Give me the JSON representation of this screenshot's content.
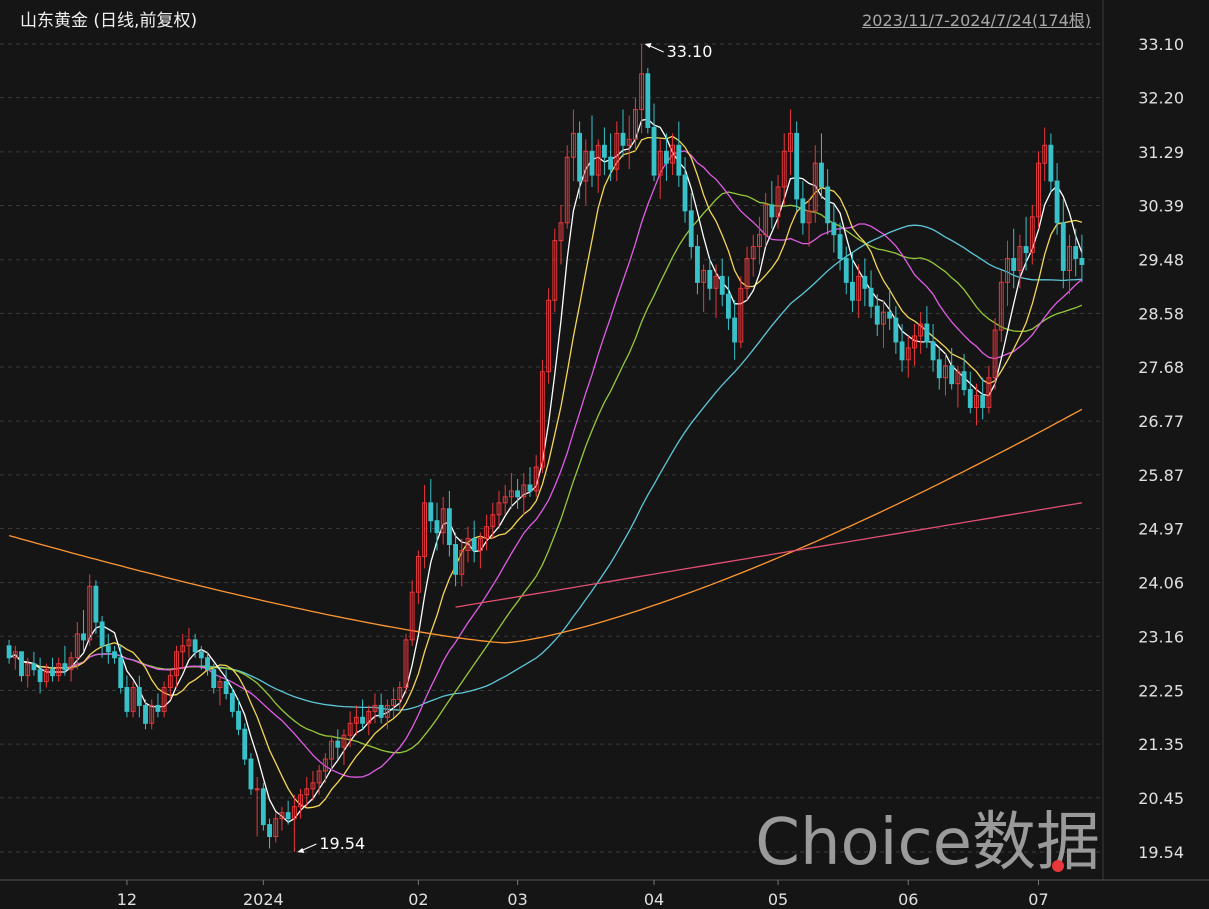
{
  "header": {
    "title": "山东黄金 (日线,前复权)",
    "date_range": "2023/11/7-2024/7/24(174根)"
  },
  "watermark": "Choice数据",
  "colors": {
    "up": "#e8373b",
    "down": "#39c1c9",
    "ma5": "#ffffff",
    "ma10": "#f5d657",
    "ma20": "#e05de6",
    "ma30": "#95c93a",
    "ma60": "#5ec8d9",
    "ma120": "#ff9632",
    "ma250": "#e0506e"
  },
  "chart_data": {
    "type": "candlestick",
    "y_ticks": [
      33.1,
      32.2,
      31.29,
      30.39,
      29.48,
      28.58,
      27.68,
      26.77,
      25.87,
      24.97,
      24.06,
      23.16,
      22.25,
      21.35,
      20.45,
      19.54
    ],
    "x_ticks": [
      "12",
      "2024",
      "02",
      "03",
      "04",
      "05",
      "06",
      "07"
    ],
    "annotations": [
      {
        "label": "33.10",
        "value": 33.1,
        "type": "high",
        "bar": 102
      },
      {
        "label": "19.54",
        "value": 19.54,
        "type": "low",
        "bar": 46
      }
    ],
    "candles": [
      [
        23.0,
        23.1,
        22.7,
        22.8
      ],
      [
        22.8,
        23.0,
        22.6,
        22.9
      ],
      [
        22.9,
        22.9,
        22.4,
        22.5
      ],
      [
        22.5,
        22.8,
        22.3,
        22.7
      ],
      [
        22.7,
        22.9,
        22.5,
        22.6
      ],
      [
        22.6,
        22.8,
        22.2,
        22.4
      ],
      [
        22.4,
        22.7,
        22.3,
        22.6
      ],
      [
        22.6,
        22.8,
        22.4,
        22.5
      ],
      [
        22.5,
        22.8,
        22.4,
        22.7
      ],
      [
        22.7,
        23.0,
        22.5,
        22.6
      ],
      [
        22.6,
        22.9,
        22.4,
        22.8
      ],
      [
        22.8,
        23.4,
        22.6,
        23.2
      ],
      [
        23.2,
        23.6,
        22.9,
        23.1
      ],
      [
        23.1,
        24.2,
        23.0,
        24.0
      ],
      [
        24.0,
        24.1,
        23.2,
        23.4
      ],
      [
        23.4,
        23.5,
        22.8,
        23.0
      ],
      [
        23.0,
        23.2,
        22.7,
        22.9
      ],
      [
        22.9,
        23.0,
        22.7,
        22.8
      ],
      [
        22.8,
        23.0,
        22.2,
        22.3
      ],
      [
        22.3,
        22.5,
        21.8,
        21.9
      ],
      [
        21.9,
        22.4,
        21.8,
        22.3
      ],
      [
        22.3,
        22.5,
        21.8,
        22.0
      ],
      [
        22.0,
        22.1,
        21.6,
        21.7
      ],
      [
        21.7,
        22.1,
        21.6,
        22.0
      ],
      [
        22.0,
        22.2,
        21.8,
        21.9
      ],
      [
        21.9,
        22.4,
        21.8,
        22.3
      ],
      [
        22.3,
        22.6,
        22.1,
        22.5
      ],
      [
        22.5,
        23.0,
        22.3,
        22.9
      ],
      [
        22.9,
        23.2,
        22.6,
        23.0
      ],
      [
        23.0,
        23.3,
        22.8,
        23.1
      ],
      [
        23.1,
        23.2,
        22.8,
        22.9
      ],
      [
        22.9,
        23.0,
        22.6,
        22.8
      ],
      [
        22.8,
        22.9,
        22.5,
        22.6
      ],
      [
        22.6,
        22.7,
        22.2,
        22.3
      ],
      [
        22.3,
        22.5,
        22.0,
        22.4
      ],
      [
        22.4,
        22.6,
        22.1,
        22.2
      ],
      [
        22.2,
        22.3,
        21.8,
        21.9
      ],
      [
        21.9,
        22.1,
        21.5,
        21.6
      ],
      [
        21.6,
        21.7,
        21.0,
        21.1
      ],
      [
        21.1,
        21.2,
        20.5,
        20.6
      ],
      [
        20.6,
        20.8,
        19.8,
        20.6
      ],
      [
        20.6,
        20.7,
        19.9,
        20.0
      ],
      [
        20.0,
        20.1,
        19.6,
        19.8
      ],
      [
        19.8,
        20.2,
        19.7,
        20.1
      ],
      [
        20.1,
        20.3,
        19.9,
        20.2
      ],
      [
        20.2,
        20.4,
        20.0,
        20.1
      ],
      [
        20.1,
        20.5,
        19.54,
        20.3
      ],
      [
        20.3,
        20.6,
        20.1,
        20.5
      ],
      [
        20.5,
        20.8,
        20.3,
        20.6
      ],
      [
        20.6,
        20.9,
        20.4,
        20.7
      ],
      [
        20.7,
        21.0,
        20.5,
        20.9
      ],
      [
        20.9,
        21.2,
        20.7,
        21.1
      ],
      [
        21.1,
        21.5,
        20.9,
        21.4
      ],
      [
        21.4,
        21.6,
        21.1,
        21.3
      ],
      [
        21.3,
        21.6,
        21.0,
        21.5
      ],
      [
        21.5,
        21.9,
        21.3,
        21.7
      ],
      [
        21.7,
        22.0,
        21.5,
        21.8
      ],
      [
        21.8,
        22.1,
        21.6,
        21.7
      ],
      [
        21.7,
        22.0,
        21.5,
        21.9
      ],
      [
        21.9,
        22.2,
        21.7,
        22.0
      ],
      [
        22.0,
        22.2,
        21.7,
        21.8
      ],
      [
        21.8,
        22.1,
        21.6,
        22.0
      ],
      [
        22.0,
        22.3,
        21.8,
        22.1
      ],
      [
        22.1,
        22.4,
        21.9,
        22.3
      ],
      [
        22.3,
        23.2,
        22.2,
        23.1
      ],
      [
        23.1,
        24.1,
        23.0,
        23.9
      ],
      [
        23.9,
        24.6,
        23.7,
        24.5
      ],
      [
        24.5,
        25.7,
        24.3,
        25.4
      ],
      [
        25.4,
        25.8,
        24.9,
        25.1
      ],
      [
        25.1,
        25.4,
        24.6,
        24.9
      ],
      [
        24.9,
        25.5,
        24.7,
        25.3
      ],
      [
        25.3,
        25.6,
        24.5,
        24.7
      ],
      [
        24.7,
        24.9,
        24.0,
        24.2
      ],
      [
        24.2,
        24.8,
        24.0,
        24.6
      ],
      [
        24.6,
        25.0,
        24.4,
        24.8
      ],
      [
        24.8,
        25.1,
        24.4,
        24.6
      ],
      [
        24.6,
        24.9,
        24.3,
        24.8
      ],
      [
        24.8,
        25.2,
        24.6,
        25.0
      ],
      [
        25.0,
        25.4,
        24.8,
        25.2
      ],
      [
        25.2,
        25.6,
        25.0,
        25.4
      ],
      [
        25.4,
        25.7,
        25.2,
        25.5
      ],
      [
        25.5,
        25.9,
        25.3,
        25.6
      ],
      [
        25.6,
        25.8,
        25.3,
        25.5
      ],
      [
        25.5,
        25.9,
        25.2,
        25.7
      ],
      [
        25.7,
        26.0,
        25.5,
        25.6
      ],
      [
        25.6,
        26.2,
        25.5,
        26.0
      ],
      [
        26.0,
        27.8,
        25.9,
        27.6
      ],
      [
        27.6,
        29.0,
        27.4,
        28.8
      ],
      [
        28.8,
        30.0,
        28.6,
        29.8
      ],
      [
        29.8,
        30.4,
        29.4,
        30.1
      ],
      [
        30.1,
        31.4,
        30.0,
        31.2
      ],
      [
        31.2,
        32.0,
        30.8,
        31.6
      ],
      [
        31.6,
        31.8,
        30.5,
        30.8
      ],
      [
        30.8,
        31.5,
        30.4,
        31.3
      ],
      [
        31.3,
        31.9,
        30.7,
        30.9
      ],
      [
        30.9,
        31.5,
        30.6,
        31.4
      ],
      [
        31.4,
        31.7,
        30.9,
        31.2
      ],
      [
        31.2,
        31.6,
        30.8,
        31.0
      ],
      [
        31.0,
        31.8,
        30.8,
        31.6
      ],
      [
        31.6,
        32.0,
        31.2,
        31.4
      ],
      [
        31.4,
        31.9,
        31.0,
        31.5
      ],
      [
        31.5,
        32.2,
        31.3,
        32.0
      ],
      [
        32.0,
        33.1,
        31.6,
        32.6
      ],
      [
        32.6,
        32.7,
        31.6,
        31.7
      ],
      [
        31.7,
        32.1,
        30.8,
        30.9
      ],
      [
        30.9,
        31.5,
        30.5,
        31.3
      ],
      [
        31.3,
        31.6,
        30.8,
        31.1
      ],
      [
        31.1,
        31.6,
        30.9,
        31.4
      ],
      [
        31.4,
        31.8,
        30.7,
        30.9
      ],
      [
        30.9,
        31.2,
        30.1,
        30.3
      ],
      [
        30.3,
        30.6,
        29.5,
        29.7
      ],
      [
        29.7,
        29.9,
        28.9,
        29.1
      ],
      [
        29.1,
        29.4,
        28.6,
        29.3
      ],
      [
        29.3,
        29.5,
        28.8,
        29.0
      ],
      [
        29.0,
        29.4,
        28.5,
        29.2
      ],
      [
        29.2,
        29.5,
        28.7,
        28.9
      ],
      [
        28.9,
        29.2,
        28.3,
        28.5
      ],
      [
        28.5,
        28.8,
        27.8,
        28.1
      ],
      [
        28.1,
        29.2,
        28.0,
        29.0
      ],
      [
        29.0,
        29.7,
        28.8,
        29.5
      ],
      [
        29.5,
        29.9,
        29.2,
        29.7
      ],
      [
        29.7,
        30.2,
        29.4,
        29.9
      ],
      [
        29.9,
        30.6,
        29.7,
        30.4
      ],
      [
        30.4,
        30.8,
        30.0,
        30.2
      ],
      [
        30.2,
        30.9,
        30.0,
        30.7
      ],
      [
        30.7,
        31.6,
        30.4,
        31.3
      ],
      [
        31.3,
        32.0,
        30.9,
        31.6
      ],
      [
        31.6,
        31.8,
        30.3,
        30.5
      ],
      [
        30.5,
        30.8,
        29.9,
        30.1
      ],
      [
        30.1,
        30.5,
        29.7,
        30.3
      ],
      [
        30.3,
        31.4,
        30.1,
        31.1
      ],
      [
        31.1,
        31.6,
        30.5,
        30.7
      ],
      [
        30.7,
        31.0,
        29.9,
        30.1
      ],
      [
        30.1,
        30.4,
        29.6,
        29.9
      ],
      [
        29.9,
        30.1,
        29.3,
        29.5
      ],
      [
        29.5,
        29.7,
        28.9,
        29.1
      ],
      [
        29.1,
        29.6,
        28.6,
        28.8
      ],
      [
        28.8,
        29.4,
        28.5,
        29.2
      ],
      [
        29.2,
        29.5,
        28.7,
        29.0
      ],
      [
        29.0,
        29.3,
        28.5,
        28.7
      ],
      [
        28.7,
        28.9,
        28.2,
        28.4
      ],
      [
        28.4,
        28.8,
        28.0,
        28.6
      ],
      [
        28.6,
        29.0,
        28.3,
        28.5
      ],
      [
        28.5,
        28.7,
        27.9,
        28.1
      ],
      [
        28.1,
        28.4,
        27.6,
        27.8
      ],
      [
        27.8,
        28.2,
        27.5,
        28.0
      ],
      [
        28.0,
        28.4,
        27.7,
        28.2
      ],
      [
        28.2,
        28.6,
        27.9,
        28.4
      ],
      [
        28.4,
        28.7,
        28.0,
        28.1
      ],
      [
        28.1,
        28.4,
        27.6,
        27.8
      ],
      [
        27.8,
        28.0,
        27.3,
        27.5
      ],
      [
        27.5,
        27.9,
        27.2,
        27.7
      ],
      [
        27.7,
        28.0,
        27.3,
        27.4
      ],
      [
        27.4,
        27.7,
        27.0,
        27.6
      ],
      [
        27.6,
        27.9,
        27.2,
        27.3
      ],
      [
        27.3,
        27.6,
        26.9,
        27.0
      ],
      [
        27.0,
        27.4,
        26.7,
        27.2
      ],
      [
        27.2,
        27.5,
        26.8,
        27.0
      ],
      [
        27.0,
        27.7,
        26.9,
        27.5
      ],
      [
        27.5,
        28.5,
        27.3,
        28.3
      ],
      [
        28.3,
        29.3,
        28.1,
        29.1
      ],
      [
        29.1,
        29.8,
        28.7,
        29.5
      ],
      [
        29.5,
        30.0,
        29.0,
        29.3
      ],
      [
        29.3,
        29.9,
        29.0,
        29.7
      ],
      [
        29.7,
        30.2,
        29.3,
        29.6
      ],
      [
        29.6,
        30.4,
        29.4,
        30.2
      ],
      [
        30.2,
        31.3,
        30.0,
        31.1
      ],
      [
        31.1,
        31.7,
        30.8,
        31.4
      ],
      [
        31.4,
        31.6,
        30.6,
        30.8
      ],
      [
        30.8,
        31.1,
        29.9,
        30.1
      ],
      [
        30.1,
        30.5,
        29.0,
        29.3
      ],
      [
        29.3,
        29.9,
        28.9,
        29.7
      ],
      [
        29.7,
        30.0,
        29.2,
        29.5
      ],
      [
        29.5,
        29.9,
        29.1,
        29.4
      ]
    ]
  }
}
